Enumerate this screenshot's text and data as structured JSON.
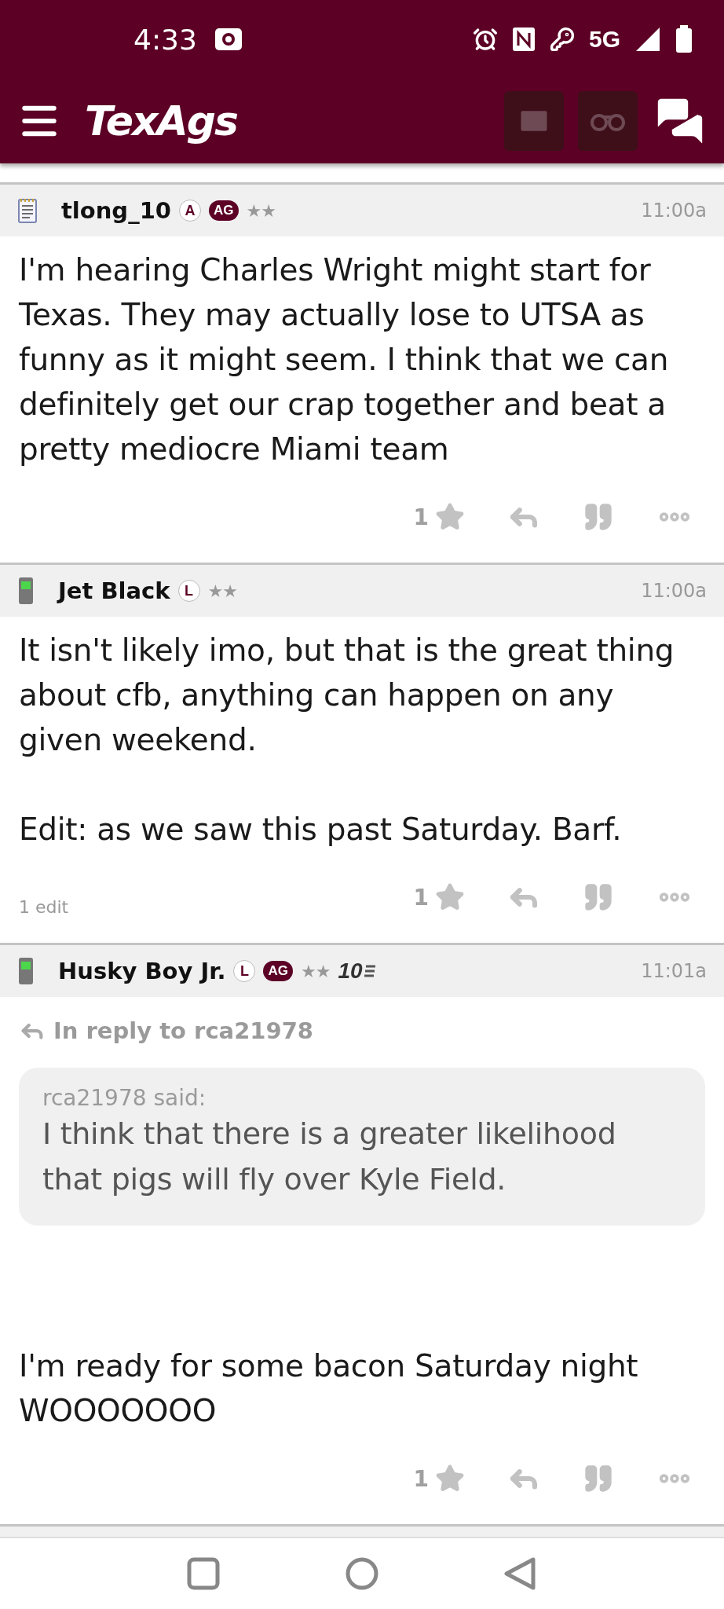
{
  "status_bar": {
    "time": "4:33",
    "network": "5G"
  },
  "header": {
    "logo": "TexAgs"
  },
  "posts": [
    {
      "author": "tlong_10",
      "avatar": {
        "kind": "notepad"
      },
      "badges": [
        {
          "kind": "circle",
          "text": "A"
        },
        {
          "kind": "pill",
          "text": "AG"
        },
        {
          "kind": "stars",
          "text": "★★"
        }
      ],
      "time": "11:00a",
      "body": [
        "I'm hearing Charles Wright might start for Texas. They may actually lose to UTSA as funny as it might seem. I think that we can definitely get our crap together and beat a pretty mediocre Miami team"
      ],
      "likes": "1"
    },
    {
      "author": "Jet Black",
      "avatar": {
        "kind": "phone"
      },
      "badges": [
        {
          "kind": "circle",
          "text": "L"
        },
        {
          "kind": "stars",
          "text": "★★"
        }
      ],
      "time": "11:00a",
      "body": [
        "It isn't likely imo, but that is the great thing about cfb, anything can happen on any given weekend.",
        "Edit: as we saw this past Saturday. Barf."
      ],
      "edits": "1 edit",
      "likes": "1"
    },
    {
      "author": "Husky Boy Jr.",
      "avatar": {
        "kind": "phone"
      },
      "badges": [
        {
          "kind": "circle",
          "text": "L"
        },
        {
          "kind": "pill",
          "text": "AG"
        },
        {
          "kind": "stars",
          "text": "★★"
        }
      ],
      "rank": "10",
      "time": "11:01a",
      "reply_to": "In reply to rca21978",
      "quote": {
        "said": "rca21978 said:",
        "text": "I think that there is a greater likelihood that pigs will fly over Kyle Field."
      },
      "body": [
        "I'm ready for some bacon Saturday night WOOOOOOO"
      ],
      "likes": "1"
    }
  ]
}
